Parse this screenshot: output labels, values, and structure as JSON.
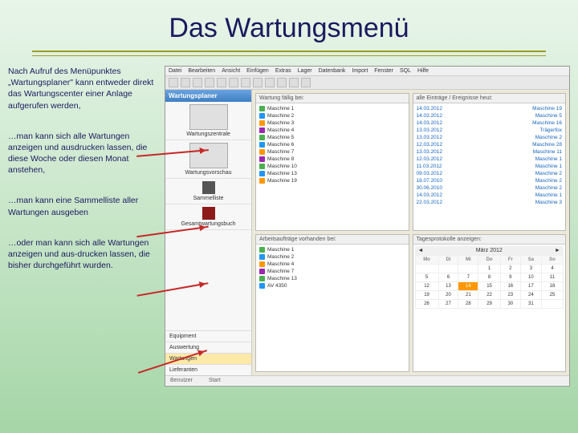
{
  "slide": {
    "title": "Das Wartungsmenü",
    "p1": "Nach Aufruf des Menüpunktes „Wartungsplaner\" kann entweder direkt das Wartungscenter einer Anlage aufgerufen werden,",
    "p2": "…man kann sich alle Wartungen anzeigen und ausdrucken lassen, die diese Woche oder diesen Monat anstehen,",
    "p3": "…man kann eine Sammelliste aller Wartungen ausgeben",
    "p4": "…oder man kann sich alle Wartungen anzeigen und aus-drucken lassen, die bisher durchgeführt wurden."
  },
  "app": {
    "menu": [
      "Datei",
      "Bearbeiten",
      "Ansicht",
      "Einfügen",
      "Extras",
      "Lager",
      "Datenbank",
      "Import",
      "Fenster",
      "SQL",
      "Hilfe"
    ],
    "sidebar": {
      "header": "Wartungsplaner",
      "items": [
        "Wartungszentrale",
        "Wartungsvorschau",
        "Sammelliste",
        "Gesamtwartungsbuch"
      ],
      "nav": [
        "Equipment",
        "Auswertung",
        "Wartungen",
        "Lieferanten"
      ],
      "navActive": "Wartungen"
    },
    "panes": {
      "due": {
        "title": "Wartung fällig bei:",
        "items": [
          "Maschine 1",
          "Maschine 2",
          "Maschine 3",
          "Maschine 4",
          "Maschine 5",
          "Maschine 6",
          "Maschine 7",
          "Maschine 8",
          "Maschine 10",
          "Maschine 13",
          "Maschine 19"
        ]
      },
      "entries": {
        "title": "alle Einträge / Ereignisse heut:",
        "rows": [
          {
            "d": "14.03.2012",
            "m": "Maschine 19"
          },
          {
            "d": "14.03.2012",
            "m": "Maschine 5"
          },
          {
            "d": "14.03.2012",
            "m": "Maschine 16"
          },
          {
            "d": "13.03.2012",
            "m": "Trägerfox"
          },
          {
            "d": "13.03.2012",
            "m": "Maschine 2"
          },
          {
            "d": "12.03.2012",
            "m": "Maschine 28"
          },
          {
            "d": "13.03.2012",
            "m": "Maschine 11"
          },
          {
            "d": "12.03.2012",
            "m": "Maschine 1"
          },
          {
            "d": "11.03.2012",
            "m": "Maschine 1"
          },
          {
            "d": "09.03.2012",
            "m": "Maschine 2"
          },
          {
            "d": "18.07.2010",
            "m": "Maschine 2"
          },
          {
            "d": "30.06.2010",
            "m": "Maschine 2"
          },
          {
            "d": "14.03.2012",
            "m": "Maschine 1"
          },
          {
            "d": "22.03.2012",
            "m": "Maschine 3"
          }
        ]
      },
      "orders": {
        "title": "Arbeitsaufträge vorhanden bei:",
        "items": [
          "Maschine 1",
          "Maschine 2",
          "Maschine 4",
          "Maschine 7",
          "Maschine 13",
          "AV 4350"
        ]
      },
      "cal": {
        "title": "Tagesprotokolle anzeigen:",
        "month": "März 2012",
        "dow": [
          "Mo",
          "Di",
          "Mi",
          "Do",
          "Fr",
          "Sa",
          "So"
        ],
        "weeks": [
          [
            "",
            "",
            "",
            "1",
            "2",
            "3",
            "4"
          ],
          [
            "5",
            "6",
            "7",
            "8",
            "9",
            "10",
            "11"
          ],
          [
            "12",
            "13",
            "14",
            "15",
            "16",
            "17",
            "18"
          ],
          [
            "19",
            "20",
            "21",
            "22",
            "23",
            "24",
            "25"
          ],
          [
            "26",
            "27",
            "28",
            "29",
            "30",
            "31",
            ""
          ]
        ],
        "today": "14"
      }
    },
    "status": {
      "left": "Benutzer",
      "right": "Start"
    }
  }
}
